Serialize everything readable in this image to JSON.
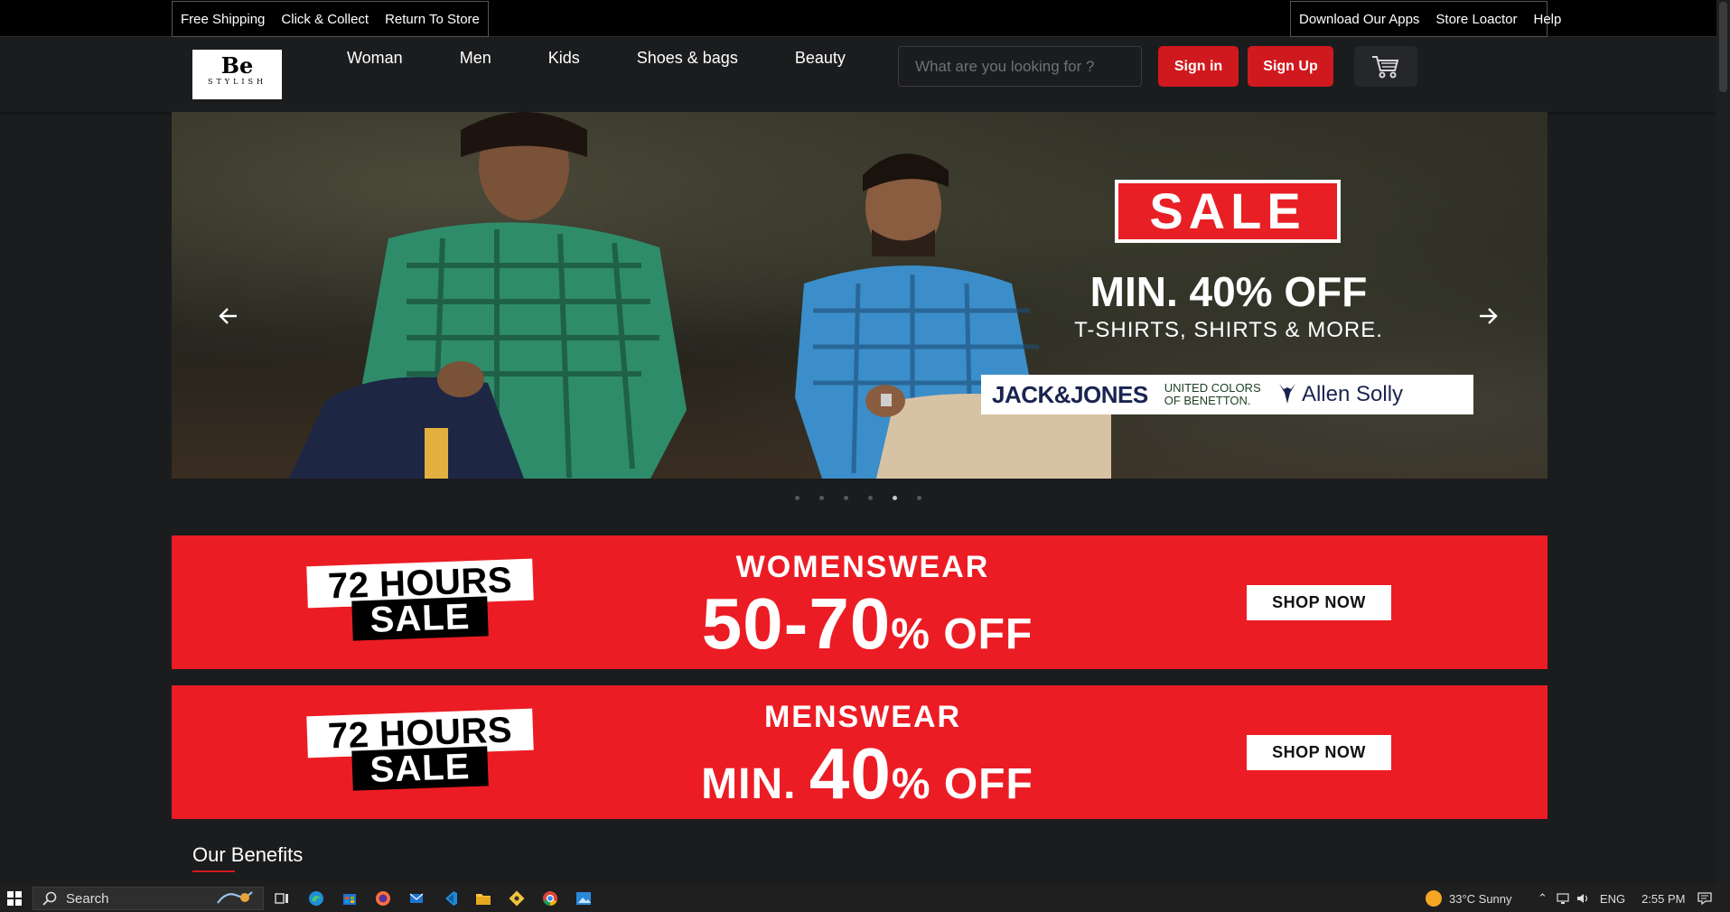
{
  "topbar": {
    "left_links": [
      "Free Shipping",
      "Click & Collect",
      "Return To Store"
    ],
    "right_links": [
      "Download Our Apps",
      "Store Loactor",
      "Help"
    ]
  },
  "header": {
    "logo": {
      "big": "Be",
      "small": "STYLISH"
    },
    "nav": [
      "Woman",
      "Men",
      "Kids",
      "Shoes & bags",
      "Beauty"
    ],
    "search_placeholder": "What are you looking for ?",
    "signin_label": "Sign in",
    "signup_label": "Sign Up",
    "cart_icon": "cart-icon"
  },
  "hero": {
    "sale": "SALE",
    "headline": "MIN. 40% OFF",
    "subline": "T-SHIRTS, SHIRTS & MORE.",
    "brands": [
      "JACK&JONES",
      "UNITED COLORS",
      "OF BENETTON.",
      "Allen Solly"
    ],
    "prev_icon": "arrow-left-icon",
    "next_icon": "arrow-right-icon",
    "dots_count": 6,
    "active_dot": 5
  },
  "promos": [
    {
      "badge_top": "72 HOURS",
      "badge_bottom": "SALE",
      "heading": "WOMENSWEAR",
      "pre": "",
      "num": "50-70",
      "off": "% OFF",
      "button": "SHOP NOW"
    },
    {
      "badge_top": "72 HOURS",
      "badge_bottom": "SALE",
      "heading": "MENSWEAR",
      "pre": "MIN. ",
      "num": "40",
      "off": "% OFF",
      "button": "SHOP NOW"
    }
  ],
  "benefits_title": "Our Benefits",
  "taskbar": {
    "search_label": "Search",
    "weather": "33°C  Sunny",
    "lang": "ENG",
    "time": "2:55 PM"
  },
  "colors": {
    "accent": "#d0191e",
    "promo": "#ec1c24",
    "bg": "#1b1c1e"
  }
}
